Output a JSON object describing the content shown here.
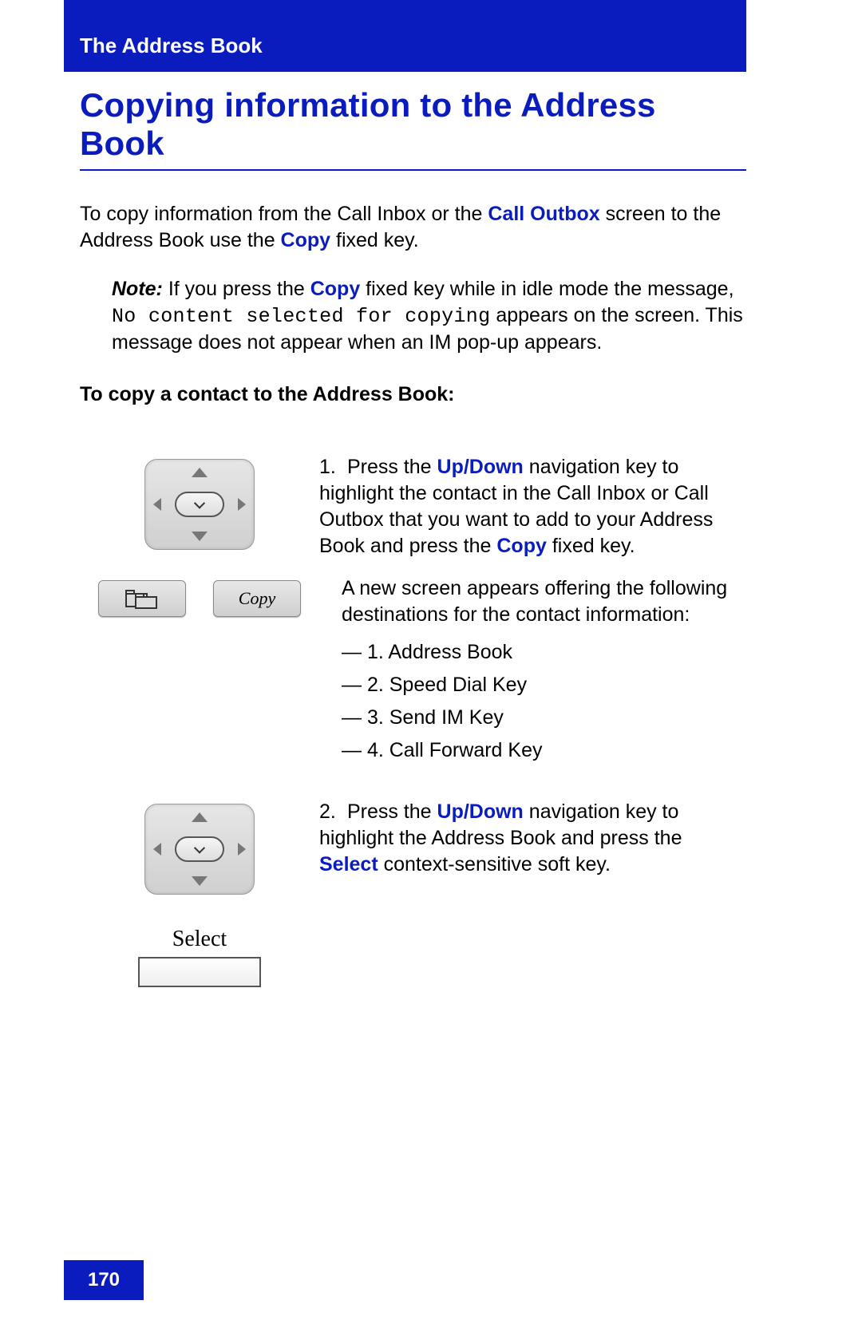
{
  "header": {
    "section": "The Address Book"
  },
  "title": "Copying information to the Address Book",
  "intro": {
    "part1": "To copy information from the Call Inbox or the ",
    "link_call_outbox": "Call Outbox",
    "part2": " screen to the Address Book use the ",
    "link_copy": "Copy",
    "part3": " fixed key."
  },
  "note": {
    "label": "Note:",
    "part1": "  If you press the ",
    "link_copy": "Copy",
    "part2": " fixed key while in idle mode the message, ",
    "mono": "No content selected for copying",
    "part3": " appears on the screen. This message does not appear when an IM pop-up appears."
  },
  "subhead": "To copy a contact to the Address Book:",
  "steps": {
    "s1": {
      "num": "1.",
      "t1": "Press the ",
      "kw_updown": "Up/Down",
      "t2": " navigation key to highlight the contact in the Call Inbox or Call Outbox that you want to add to your Address Book and press the ",
      "kw_copy": "Copy",
      "t3": " fixed key.",
      "after": "A new screen appears offering the following destinations for the contact information:",
      "dest": [
        "1. Address Book",
        "2. Speed Dial Key",
        "3. Send IM Key",
        "4. Call Forward Key"
      ],
      "copy_key_label": "Copy"
    },
    "s2": {
      "num": "2.",
      "t1": "Press the ",
      "kw_updown": "Up/Down",
      "t2": " navigation key to highlight the Address Book and press the ",
      "kw_select": "Select",
      "t3": " context-sensitive soft key.",
      "select_label": "Select"
    }
  },
  "page_number": "170"
}
